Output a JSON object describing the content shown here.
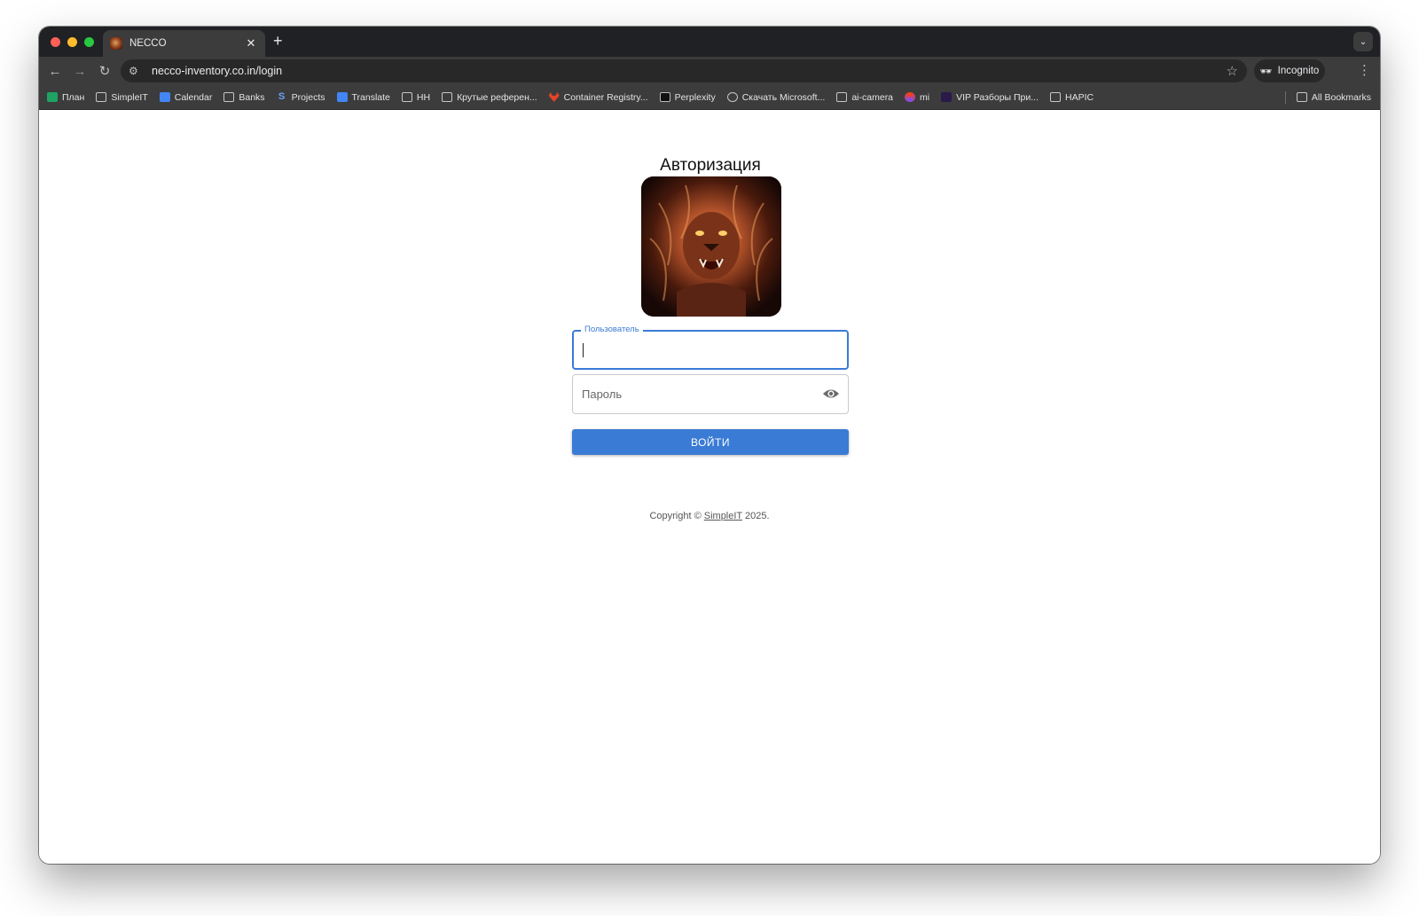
{
  "browser": {
    "tab_title": "NECCO",
    "url": "necco-inventory.co.in/login",
    "profile_label": "Incognito",
    "bookmarks": [
      {
        "label": "План",
        "icon": "sheets-icon"
      },
      {
        "label": "SimpleIT",
        "icon": "folder-icon"
      },
      {
        "label": "Calendar",
        "icon": "calendar-icon"
      },
      {
        "label": "Banks",
        "icon": "folder-icon"
      },
      {
        "label": "Projects",
        "icon": "projects-icon"
      },
      {
        "label": "Translate",
        "icon": "translate-icon"
      },
      {
        "label": "HH",
        "icon": "folder-icon"
      },
      {
        "label": "Крутые референ...",
        "icon": "folder-icon"
      },
      {
        "label": "Container Registry...",
        "icon": "gitlab-icon"
      },
      {
        "label": "Perplexity",
        "icon": "perplexity-icon"
      },
      {
        "label": "Скачать Microsoft...",
        "icon": "globe-icon"
      },
      {
        "label": "ai-camera",
        "icon": "folder-icon"
      },
      {
        "label": "mi",
        "icon": "mi-icon"
      },
      {
        "label": "VIP Разборы При...",
        "icon": "vip-icon"
      },
      {
        "label": "HAPIC",
        "icon": "folder-icon"
      }
    ],
    "all_bookmarks_label": "All Bookmarks"
  },
  "login": {
    "title": "Авторизация",
    "username_label": "Пользователь",
    "username_value": "",
    "password_placeholder": "Пароль",
    "submit_label": "ВОЙТИ"
  },
  "footer": {
    "prefix": "Copyright © ",
    "link": "SimpleIT",
    "suffix": " 2025."
  },
  "colors": {
    "accent": "#3a7bd5",
    "chrome_dark": "#202124",
    "chrome_toolbar": "#3c3c3c"
  }
}
